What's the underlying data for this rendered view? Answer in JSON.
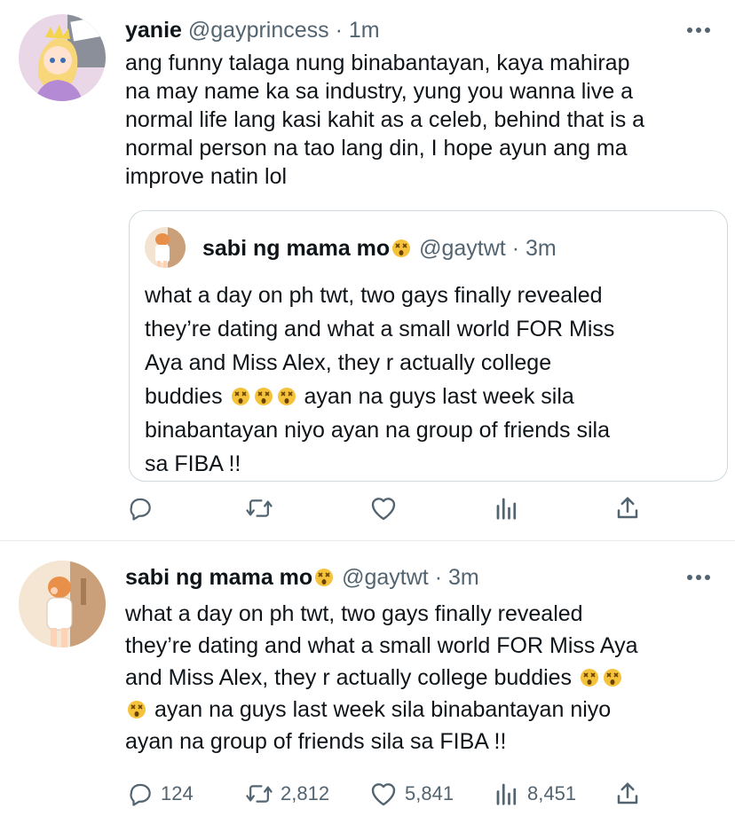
{
  "tweets": [
    {
      "display_name": "yanie",
      "handle": "@gayprincess",
      "separator": "·",
      "time": "1m",
      "lines": [
        "ang funny talaga nung binabantayan, kaya mahirap",
        "na may name ka sa industry, yung you wanna live a",
        "normal life lang kasi kahit as a celeb, behind that is a",
        "normal person na tao lang din, I hope ayun ang ma",
        "improve natin lol"
      ],
      "quoted": {
        "display_name": "sabi ng mama mo",
        "handle": "@gaytwt",
        "separator": "·",
        "time": "3m",
        "lines": [
          "what a day on ph twt, two gays finally revealed",
          "they’re dating and what a small world FOR Miss",
          "Aya and Miss Alex, they r actually college",
          "buddies",
          "ayan na guys last week sila",
          "binabantayan niyo ayan na group of friends sila",
          "sa FIBA !!"
        ]
      },
      "actions": {
        "reply_icon": "reply-icon",
        "retweet_icon": "retweet-icon",
        "like_icon": "heart-icon",
        "views_icon": "views-icon",
        "share_icon": "share-icon"
      }
    },
    {
      "display_name": "sabi ng mama mo",
      "handle": "@gaytwt",
      "separator": "·",
      "time": "3m",
      "lines": [
        "what a day on ph twt, two gays finally revealed",
        "they’re dating and what a small world FOR Miss Aya",
        "and Miss Alex, they r actually college buddies",
        "ayan na guys last week sila binabantayan niyo",
        "ayan na group of friends sila sa FIBA !!"
      ],
      "stats": {
        "replies": "124",
        "retweets": "2,812",
        "likes": "5,841",
        "views": "8,451"
      }
    }
  ],
  "colors": {
    "text": "#0f1419",
    "secondary": "#536471",
    "border": "#cfd9de",
    "emoji": "#f5c33b"
  }
}
